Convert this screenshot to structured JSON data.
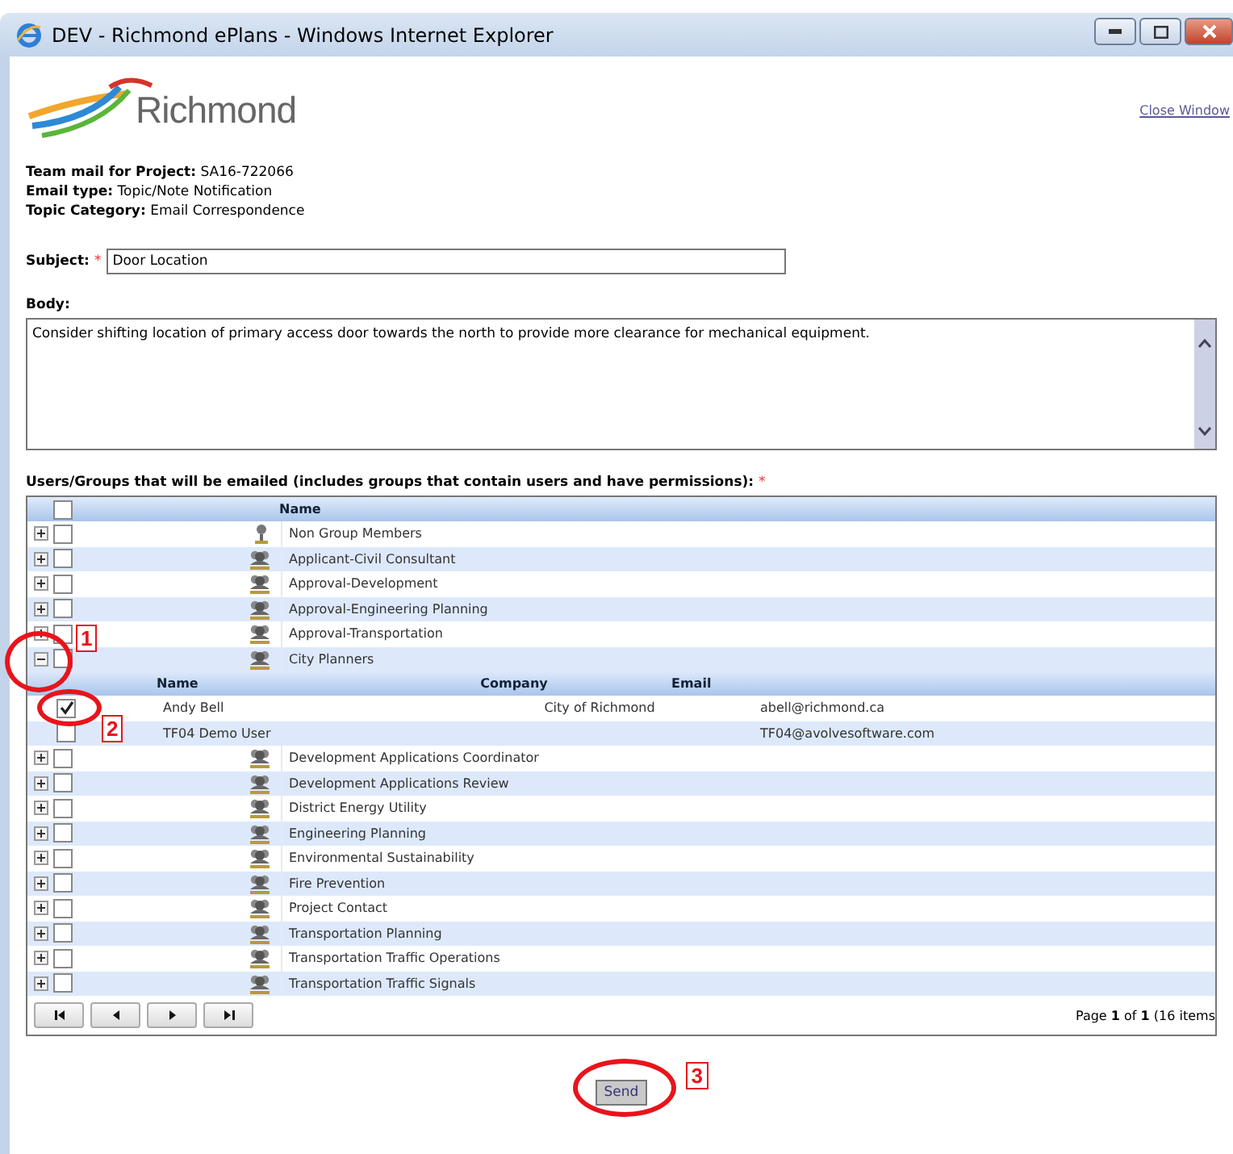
{
  "window": {
    "title": "DEV - Richmond ePlans - Windows Internet Explorer"
  },
  "header": {
    "logo_text": "Richmond",
    "close_link": "Close Window"
  },
  "info": [
    {
      "label": "Team mail for Project:",
      "value": "SA16-722066"
    },
    {
      "label": "Email type:",
      "value": "Topic/Note Notification"
    },
    {
      "label": "Topic Category:",
      "value": "Email Correspondence"
    }
  ],
  "subject": {
    "label": "Subject:",
    "required_mark": "*",
    "value": "Door Location"
  },
  "body": {
    "label": "Body:",
    "value": "Consider shifting location of primary access door towards the north to provide more clearance for mechanical equipment."
  },
  "recipients": {
    "label": "Users/Groups that will be emailed (includes groups that contain users and have permissions):",
    "required_mark": "*",
    "header": {
      "name": "Name",
      "checked": false
    },
    "groups": [
      {
        "name": "Non Group Members",
        "kind": "person",
        "expanded": false,
        "checked": false
      },
      {
        "name": "Applicant-Civil Consultant",
        "kind": "group",
        "expanded": false,
        "checked": false
      },
      {
        "name": "Approval-Development",
        "kind": "group",
        "expanded": false,
        "checked": false
      },
      {
        "name": "Approval-Engineering Planning",
        "kind": "group",
        "expanded": false,
        "checked": false
      },
      {
        "name": "Approval-Transportation",
        "kind": "group",
        "expanded": false,
        "checked": false
      },
      {
        "name": "City Planners",
        "kind": "group",
        "expanded": true,
        "checked": false,
        "callout": "1",
        "members": {
          "columns": [
            "Name",
            "Company",
            "Email"
          ],
          "rows": [
            {
              "name": "Andy Bell",
              "company": "City of Richmond",
              "email": "abell@richmond.ca",
              "checked": true,
              "callout": "2"
            },
            {
              "name": "TF04 Demo User",
              "company": "",
              "email": "TF04@avolvesoftware.com",
              "checked": false
            }
          ]
        }
      },
      {
        "name": "Development Applications Coordinator",
        "kind": "group",
        "expanded": false,
        "checked": false
      },
      {
        "name": "Development Applications Review",
        "kind": "group",
        "expanded": false,
        "checked": false
      },
      {
        "name": "District Energy Utility",
        "kind": "group",
        "expanded": false,
        "checked": false
      },
      {
        "name": "Engineering Planning",
        "kind": "group",
        "expanded": false,
        "checked": false
      },
      {
        "name": "Environmental Sustainability",
        "kind": "group",
        "expanded": false,
        "checked": false
      },
      {
        "name": "Fire Prevention",
        "kind": "group",
        "expanded": false,
        "checked": false
      },
      {
        "name": "Project Contact",
        "kind": "group",
        "expanded": false,
        "checked": false
      },
      {
        "name": "Transportation Planning",
        "kind": "group",
        "expanded": false,
        "checked": false
      },
      {
        "name": "Transportation Traffic Operations",
        "kind": "group",
        "expanded": false,
        "checked": false
      },
      {
        "name": "Transportation Traffic Signals",
        "kind": "group",
        "expanded": false,
        "checked": false
      }
    ],
    "pager": {
      "summary": "Page **1** of **1** (16 items"
    }
  },
  "send": {
    "label": "Send",
    "callout": "3"
  }
}
